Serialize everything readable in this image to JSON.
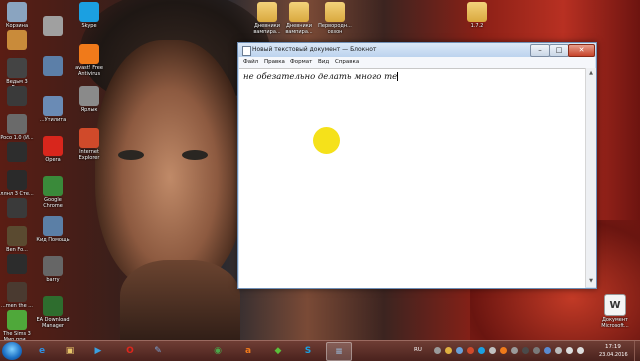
{
  "desktop": {
    "icons_left_col1": [
      {
        "label": "Корзина",
        "icon": "recycle-bin-icon",
        "color": "#8aa4c0"
      },
      {
        "label": "",
        "icon": "app-icon",
        "color": "#c98b3a"
      },
      {
        "label": "Ведьм 3 Ди...",
        "icon": "game-icon",
        "color": "#444444"
      },
      {
        "label": "",
        "icon": "game-icon",
        "color": "#3a3a3a"
      },
      {
        "label": "Poco 1.0 (И...",
        "icon": "game-icon",
        "color": "#6a6a6a"
      },
      {
        "label": "",
        "icon": "game-icon",
        "color": "#2d2d2d"
      },
      {
        "label": "ллнл 3 Сте...",
        "icon": "game-icon",
        "color": "#2a2a2a"
      },
      {
        "label": "",
        "icon": "game-icon",
        "color": "#3a3a3a"
      },
      {
        "label": "Ben Fo...",
        "icon": "game-icon",
        "color": "#5a4a30"
      },
      {
        "label": "",
        "icon": "game-icon",
        "color": "#2c2c2c"
      },
      {
        "label": "...men the ...",
        "icon": "game-icon",
        "color": "#4a3a30"
      },
      {
        "label": "The Sims 3 Мир при...",
        "icon": "sims-icon",
        "color": "#4fa83a"
      }
    ],
    "icons_left_col2": [
      {
        "label": "",
        "icon": "photo-icon",
        "color": "#a0a0a0"
      },
      {
        "label": "",
        "icon": "app-icon",
        "color": "#5c7fa8"
      },
      {
        "label": "...Утилита",
        "icon": "app-icon",
        "color": "#6a8bb5"
      },
      {
        "label": "Opera",
        "icon": "opera-icon",
        "color": "#d8261c"
      },
      {
        "label": "Google Chrome",
        "icon": "chrome-icon",
        "color": "#3a8a3a"
      },
      {
        "label": "Кид Помощь",
        "icon": "computer-icon",
        "color": "#5b7fa6"
      },
      {
        "label": "barry",
        "icon": "photo-icon",
        "color": "#666666"
      },
      {
        "label": "EA Download Manager",
        "icon": "ea-icon",
        "color": "#2e6d2e"
      }
    ],
    "icons_left_col3": [
      {
        "label": "Skype",
        "icon": "skype-icon",
        "color": "#1ba0e1"
      },
      {
        "label": "avast! Free Antivirus",
        "icon": "avast-icon",
        "color": "#f07a1a"
      },
      {
        "label": "Ярлык",
        "icon": "app-icon",
        "color": "#8a8a8a"
      },
      {
        "label": "Internet Explorer",
        "icon": "ie-icon",
        "color": "#d04a2a"
      }
    ],
    "icons_top_folders": [
      {
        "label": "Дневники вампира...",
        "icon": "folder-icon"
      },
      {
        "label": "Дневники вампира...",
        "icon": "folder-icon"
      },
      {
        "label": "Первородн... сезон",
        "icon": "folder-icon"
      },
      {
        "label": "1.7.2",
        "icon": "folder-icon"
      }
    ],
    "icon_bottom_right": {
      "label": "Документ Microsoft...",
      "icon": "document-icon"
    }
  },
  "notepad": {
    "title": "Новый текстовый документ — Блокнот",
    "menu": [
      "Файл",
      "Правка",
      "Формат",
      "Вид",
      "Справка"
    ],
    "content": "не обезательно делать много те",
    "buttons": {
      "minimize": "–",
      "maximize": "□",
      "close": "✕"
    }
  },
  "taskbar": {
    "pinned": [
      {
        "name": "ie-icon",
        "glyph": "e",
        "color": "#2f8fe0"
      },
      {
        "name": "explorer-icon",
        "glyph": "▣",
        "color": "#e8c56a"
      },
      {
        "name": "media-player-icon",
        "glyph": "▶",
        "color": "#3aa0e0"
      },
      {
        "name": "opera-icon",
        "glyph": "O",
        "color": "#e0261c"
      },
      {
        "name": "paint-icon",
        "glyph": "✎",
        "color": "#7aa0d0"
      },
      {
        "name": "chrome-icon",
        "glyph": "◉",
        "color": "#4aa84a"
      },
      {
        "name": "avast-icon",
        "glyph": "a",
        "color": "#f07a1a"
      },
      {
        "name": "sims-icon",
        "glyph": "◆",
        "color": "#5ac03a"
      },
      {
        "name": "skype-icon",
        "glyph": "S",
        "color": "#1ba0e1"
      },
      {
        "name": "notepad-icon",
        "glyph": "≡",
        "color": "#9ab8d8"
      }
    ],
    "language": "RU",
    "time": "17:19",
    "date": "23.04.2016"
  }
}
